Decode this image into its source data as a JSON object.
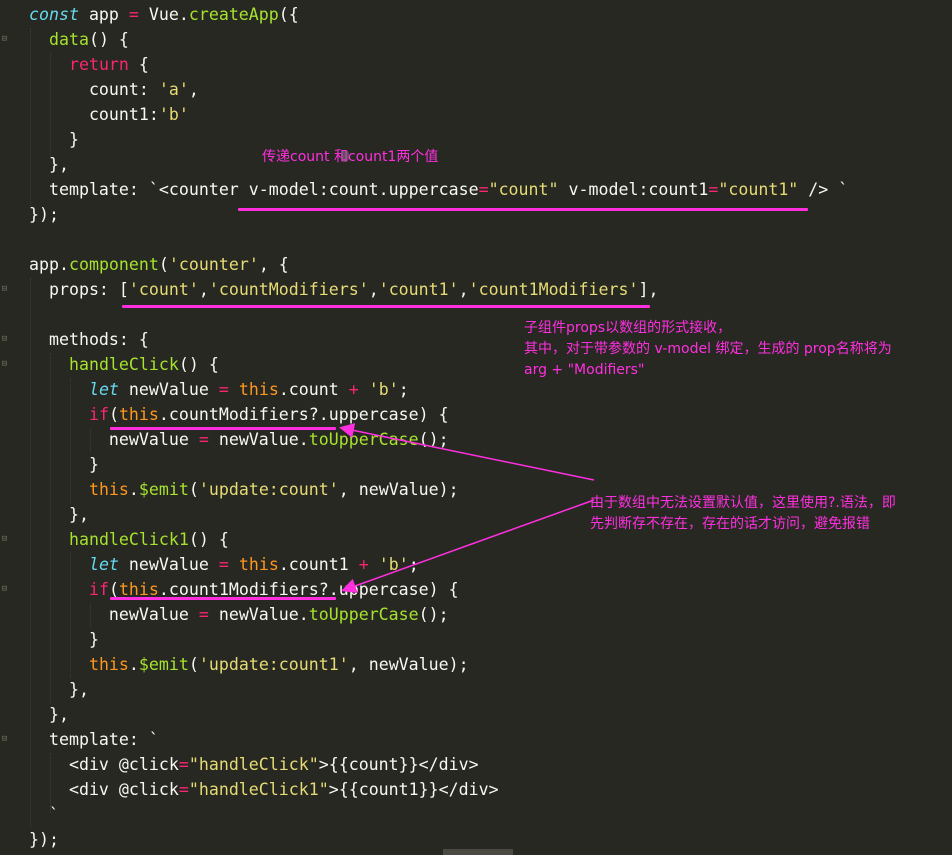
{
  "editor": {
    "theme_colors": {
      "background": "#272822",
      "keyword": "#66d9ef",
      "function": "#a6e22e",
      "string": "#e6db74",
      "operator": "#f92672",
      "this": "#fd971f",
      "annotation": "#ff2fe0"
    },
    "lines": [
      "const app = Vue.createApp({",
      "  data() {",
      "    return {",
      "      count: 'a',",
      "      count1:'b'",
      "    }",
      "  },",
      "  template: `<counter v-model:count.uppercase=\"count\" v-model:count1=\"count1\" /> `",
      "});",
      "",
      "app.component('counter', {",
      "  props: ['count','countModifiers','count1','count1Modifiers'],",
      "",
      "  methods: {",
      "    handleClick() {",
      "      let newValue = this.count + 'b';",
      "      if(this.countModifiers?.uppercase) {",
      "        newValue = newValue.toUpperCase();",
      "      }",
      "      this.$emit('update:count', newValue);",
      "    },",
      "    handleClick1() {",
      "      let newValue = this.count1 + 'b';",
      "      if(this.count1Modifiers?.uppercase) {",
      "        newValue = newValue.toUpperCase();",
      "      }",
      "      this.$emit('update:count1', newValue);",
      "    },",
      "  },",
      "  template: `",
      "    <div @click=\"handleClick\">{{count}}</div>",
      "    <div @click=\"handleClick1\">{{count1}}</div>",
      "  `",
      "});"
    ]
  },
  "annotations": {
    "note1": "传递count 和count1两个值",
    "note2_line1": "子组件props以数组的形式接收，",
    "note2_line2": "其中，对于带参数的 v-model 绑定，生成的 prop名称将为",
    "note2_line3": "arg + \"Modifiers\"",
    "note3_line1": "由于数组中无法设置默认值，这里使用?.语法，即",
    "note3_line2": "先判断存不存在，存在的话才访问，避免报错"
  }
}
